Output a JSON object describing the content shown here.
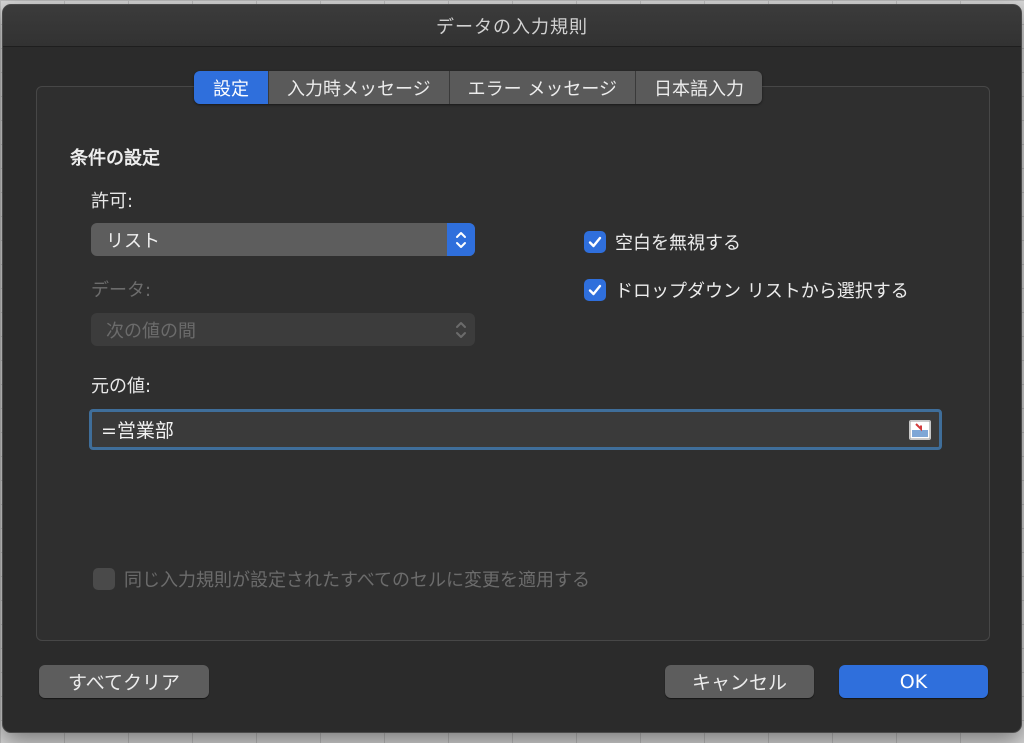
{
  "window": {
    "title": "データの入力規則"
  },
  "tabs": [
    {
      "label": "設定",
      "active": true
    },
    {
      "label": "入力時メッセージ",
      "active": false
    },
    {
      "label": "エラー メッセージ",
      "active": false
    },
    {
      "label": "日本語入力",
      "active": false
    }
  ],
  "settings": {
    "section_title": "条件の設定",
    "allow_label": "許可:",
    "allow_value": "リスト",
    "data_label": "データ:",
    "data_value": "次の値の間",
    "ignore_blank_label": "空白を無視する",
    "ignore_blank_checked": true,
    "dropdown_label": "ドロップダウン リストから選択する",
    "dropdown_checked": true,
    "source_label": "元の値:",
    "source_value": "=営業部",
    "apply_all_label": "同じ入力規則が設定されたすべてのセルに変更を適用する",
    "apply_all_checked": false
  },
  "buttons": {
    "clear_all": "すべてクリア",
    "cancel": "キャンセル",
    "ok": "OK"
  },
  "colors": {
    "accent": "#2f6fdc",
    "dialog_bg": "#2b2b2b",
    "focus_ring": "#3f6e9a"
  },
  "icons": {
    "stepper": "updown-chevron-icon",
    "checkmark": "checkmark-icon",
    "collapse": "range-collapse-icon"
  }
}
